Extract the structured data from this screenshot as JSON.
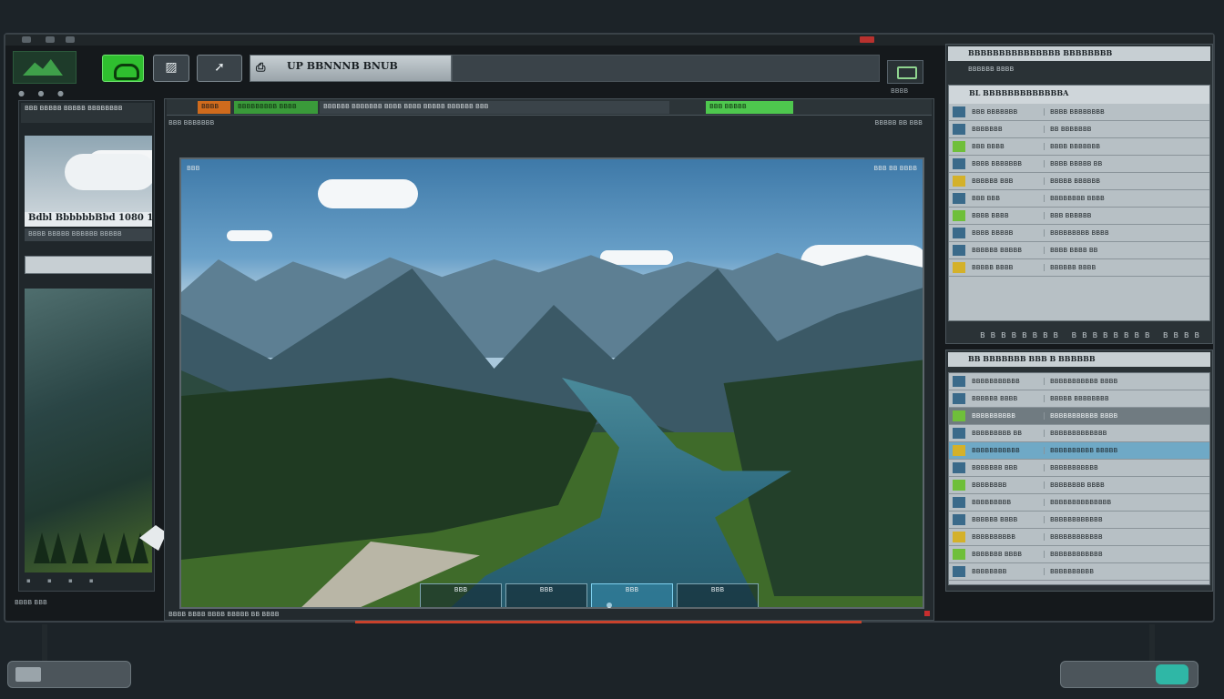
{
  "colors": {
    "accent_green": "#2fbf2f",
    "record_red": "#b8312e",
    "progress_red": "#c8422c",
    "teal": "#2fb7a6"
  },
  "toolbar": {
    "logo_icon": "mountain-logo-icon",
    "cloud_button_icon": "cloud-icon",
    "image_button_label": "▨",
    "share_button_label": "➚",
    "title_icon_label": "⎙",
    "title_text": "UP BBNNNB BNUB",
    "small_control_label": "BBBB"
  },
  "left_panel": {
    "header": "BBB BBBBB BBBBB BBBBBBBB",
    "thumb_label": "Bdbl BbbbbbBbd 1080 1",
    "thumb_sub": "BBBB BBBBB BBBBBB BBBBB"
  },
  "main": {
    "tabs": [
      "BBBB",
      "BBBBBBBBB BBBB",
      "BBBBBB BBBBBBB BBBB BBBB BBBBB BBBBBB BBB",
      "BBB BBBBB"
    ],
    "breadcrumb": "BBB BBBBBBB",
    "breadcrumb_right": "BBBBB BB BBB",
    "viewport_label": "BBB",
    "viewport_label_right": "BBB BB BBBB",
    "hud": [
      "BBB",
      "BBB",
      "BBB",
      "BBB"
    ],
    "status": "BBBB BBBB BBBB BBBBB BB BBBB"
  },
  "right_top": {
    "title": "BBBBBBBBBBBBBBB BBBBBBBB",
    "subtitle": "BBBBBB BBBB",
    "sheet_header": "BL BBBBBBBBBBBBBA",
    "rows": [
      [
        "BBB BBBBBBB",
        "BBBB BBBBBBBB"
      ],
      [
        "BBBBBBB",
        "BB BBBBBBB"
      ],
      [
        "BBB BBBB",
        "BBBB BBBBBBB"
      ],
      [
        "BBBB BBBBBBB",
        "BBBB BBBBB BB"
      ],
      [
        "BBBBBB BBB",
        "BBBBB BBBBBB"
      ],
      [
        "BBB BBB",
        "BBBBBBBB BBBB"
      ],
      [
        "BBBB BBBB",
        "BBB BBBBBB"
      ],
      [
        "BBBB BBBBB",
        "BBBBBBBBB BBBB"
      ],
      [
        "BBBBBB BBBBB",
        "BBBB BBBB BB"
      ],
      [
        "BBBBB BBBB",
        "BBBBBB BBBB"
      ]
    ],
    "footer": "BBBBBBBB BBBBBBBB BBBB"
  },
  "right_bottom": {
    "title": "BB BBBBBBB BBB B BBBBBB",
    "rows": [
      [
        "BBBBBBBBBBB",
        "BBBBBBBBBBB BBBB"
      ],
      [
        "BBBBBB BBBB",
        "BBBBB BBBBBBBB"
      ],
      [
        "BBBBBBBBBB",
        "BBBBBBBBBBB BBBB"
      ],
      [
        "BBBBBBBBB BB",
        "BBBBBBBBBBBBB"
      ],
      [
        "BBBBBBBBBBB",
        "BBBBBBBBBB BBBBB"
      ],
      [
        "BBBBBBB BBB",
        "BBBBBBBBBBB"
      ],
      [
        "BBBBBBBB",
        "BBBBBBBB BBBB"
      ],
      [
        "BBBBBBBBB",
        "BBBBBBBBBBBBBB"
      ],
      [
        "BBBBBB BBBB",
        "BBBBBBBBBBBB"
      ],
      [
        "BBBBBBBBBB",
        "BBBBBBBBBBBB"
      ],
      [
        "BBBBBBB BBBB",
        "BBBBBBBBBBBB"
      ],
      [
        "BBBBBBBB",
        "BBBBBBBBBB"
      ]
    ]
  },
  "bottom": {
    "left_text": "BBBB BBB",
    "progress": 1.0
  }
}
